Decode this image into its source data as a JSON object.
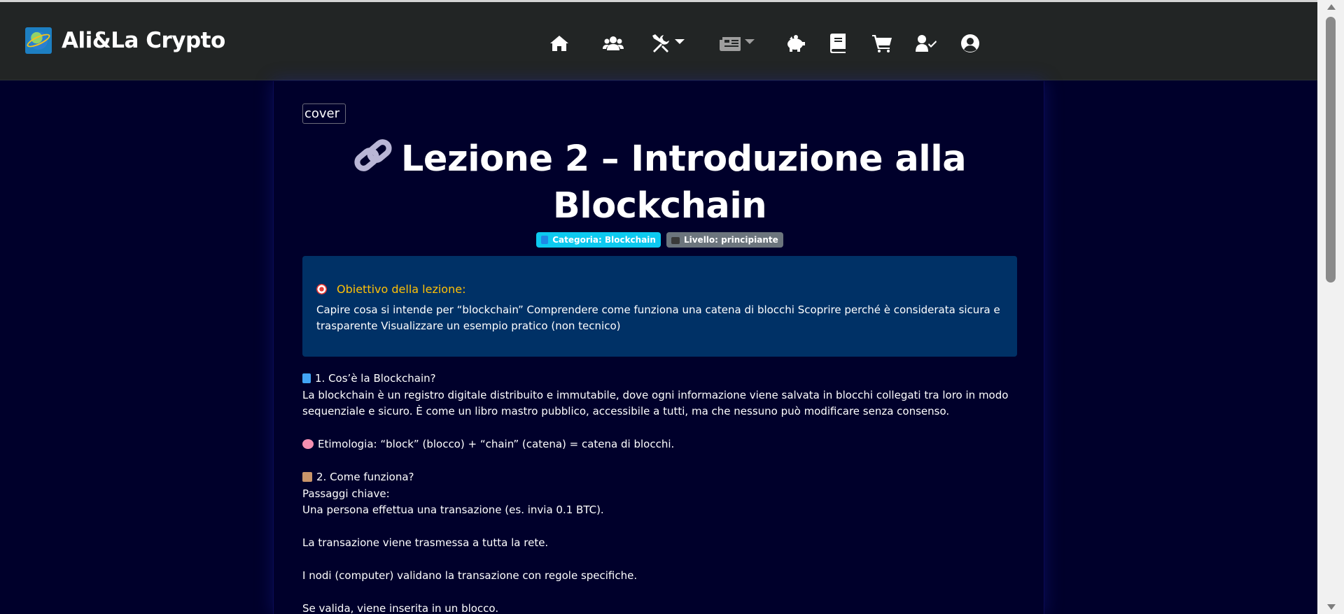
{
  "brand": {
    "name": "Ali&La Crypto"
  },
  "nav": {
    "icons": [
      "home-icon",
      "users-icon",
      "tools-icon",
      "news-icon",
      "piggy-bank-icon",
      "book-icon",
      "cart-icon",
      "user-check-icon",
      "user-circle-icon"
    ]
  },
  "article": {
    "cover_alt": "cover",
    "title": "Lezione 2 – Introduzione alla Blockchain",
    "badges": {
      "category": "Categoria: Blockchain",
      "level": "Livello: principiante"
    },
    "objective": {
      "heading": "Obiettivo della lezione:",
      "text": "Capire cosa si intende per “blockchain” Comprendere come funziona una catena di blocchi Scoprire perché è considerata sicura e trasparente Visualizzare un esempio pratico (non tecnico)"
    },
    "body": {
      "section1_heading": "1. Cos’è la Blockchain?",
      "section1_text": "La blockchain è un registro digitale distribuito e immutabile, dove ogni informazione viene salvata in blocchi collegati tra loro in modo sequenziale e sicuro. È come un libro mastro pubblico, accessibile a tutti, ma che nessuno può modificare senza consenso.",
      "etymology": "Etimologia: “block” (blocco) + “chain” (catena) = catena di blocchi.",
      "section2_heading": "2. Come funziona?",
      "steps_label": "Passaggi chiave:",
      "step1": "Una persona effettua una transazione (es. invia 0.1 BTC).",
      "step2": "La transazione viene trasmessa a tutta la rete.",
      "step3": "I nodi (computer) validano la transazione con regole specifiche.",
      "step4": "Se valida, viene inserita in un blocco."
    }
  },
  "colors": {
    "navbar": "#222525",
    "page_bg": "#00002b",
    "objective_bg": "#003166",
    "objective_heading": "#ffc107",
    "badge_category": "#0dcaf0",
    "badge_level": "#6c757d"
  }
}
